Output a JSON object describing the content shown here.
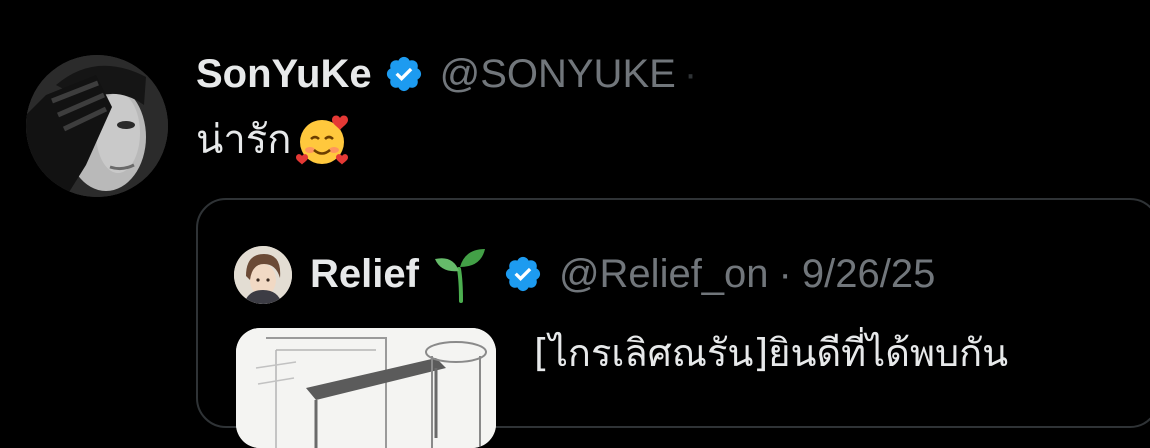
{
  "tweet": {
    "author": {
      "display_name": "SonYuKe",
      "handle": "@SONYUKE",
      "verified": true,
      "avatar_icon": "profile-photo"
    },
    "text": "น่ารัก",
    "emoji": "smiling-face-with-hearts",
    "separator": "·"
  },
  "quoted_tweet": {
    "author": {
      "display_name": "Relief",
      "name_emoji": "seedling",
      "handle": "@Relief_on",
      "verified": true,
      "avatar_icon": "illustrated-avatar"
    },
    "separator": "·",
    "date": "9/26/25",
    "text": "[ไกรเลิศณรัน]ยินดีที่ได้พบกัน",
    "thumbnail_icon": "sketch-illustration"
  },
  "colors": {
    "background": "#000000",
    "primary_text": "#e7e9ea",
    "secondary_text": "#71767b",
    "border": "#2f3336",
    "verified_blue": "#1d9bf0"
  }
}
